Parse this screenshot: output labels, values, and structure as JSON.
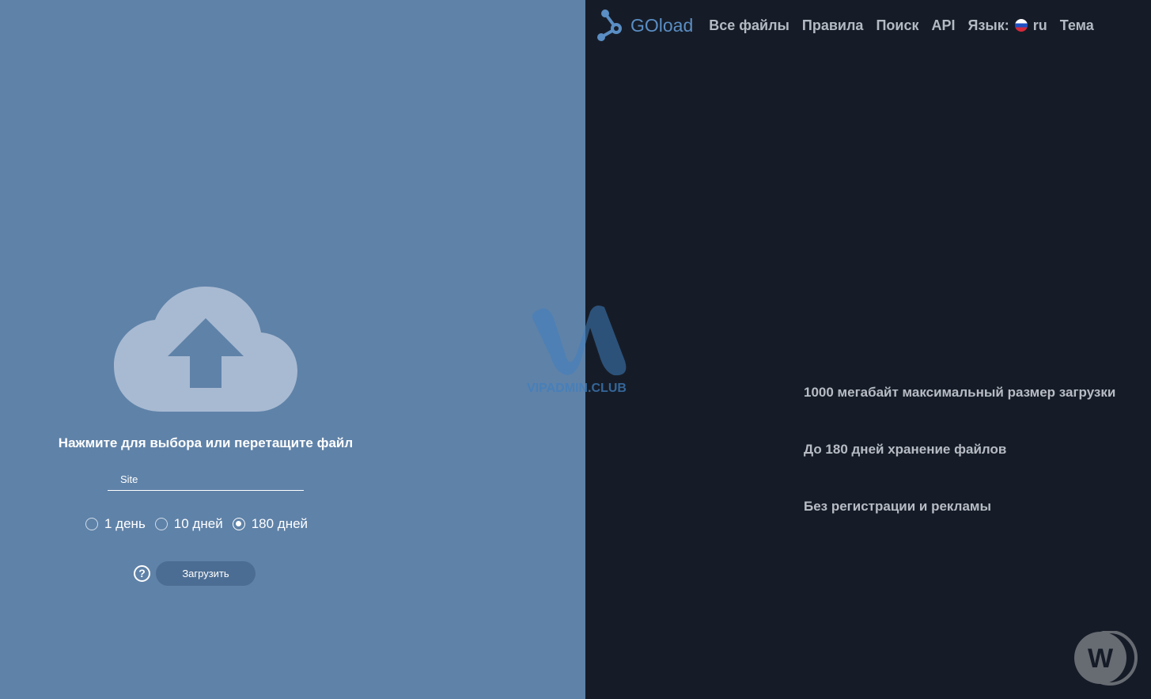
{
  "header": {
    "logo_text": "GOload",
    "nav": [
      "Все файлы",
      "Правила",
      "Поиск",
      "API"
    ],
    "language_label": "Язык:",
    "language_value": "ru",
    "theme_label": "Тема"
  },
  "upload": {
    "drop_text": "Нажмите для выбора или перетащите файл",
    "site_placeholder": "Site",
    "retention_options": [
      "1 день",
      "10 дней",
      "180 дней"
    ],
    "retention_selected": 2,
    "help_glyph": "?",
    "upload_button": "Загрузить"
  },
  "features": [
    "1000 мегабайт максимальный размер загрузки",
    "До 180 дней хранение файлов",
    "Без регистрации и рекламы"
  ],
  "watermark_text": "VIPADMIN.CLUB",
  "colors": {
    "left_bg": "#5f82a8",
    "right_bg": "#161c27",
    "accent": "#5a8ec4",
    "nav_text": "#b4bac3"
  },
  "icons": {
    "logo": "molecule-logo-icon",
    "upload": "cloud-upload-icon",
    "help": "help-circle-icon",
    "flag": "russia-flag-icon"
  }
}
